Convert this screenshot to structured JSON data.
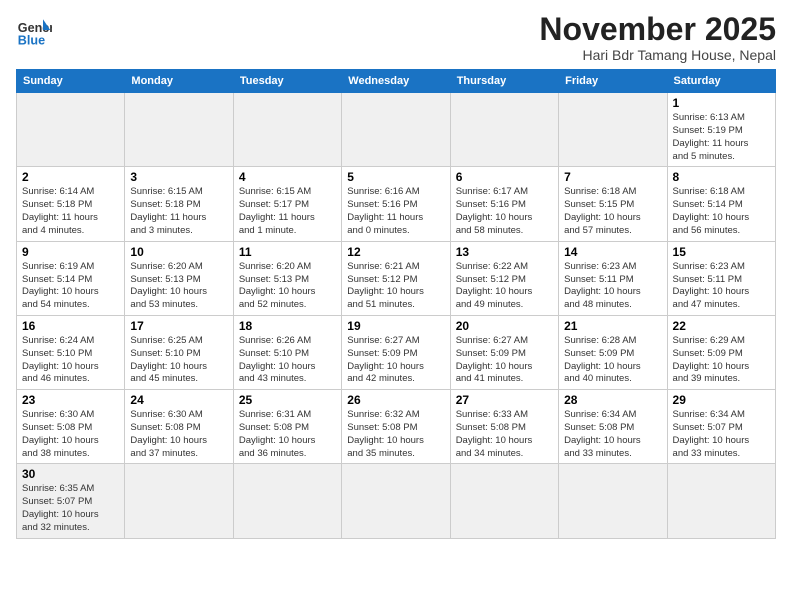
{
  "logo": {
    "general": "General",
    "blue": "Blue"
  },
  "header": {
    "month": "November 2025",
    "subtitle": "Hari Bdr Tamang House, Nepal"
  },
  "weekdays": [
    "Sunday",
    "Monday",
    "Tuesday",
    "Wednesday",
    "Thursday",
    "Friday",
    "Saturday"
  ],
  "weeks": [
    [
      {
        "day": null,
        "info": null
      },
      {
        "day": null,
        "info": null
      },
      {
        "day": null,
        "info": null
      },
      {
        "day": null,
        "info": null
      },
      {
        "day": null,
        "info": null
      },
      {
        "day": null,
        "info": null
      },
      {
        "day": "1",
        "info": "Sunrise: 6:13 AM\nSunset: 5:19 PM\nDaylight: 11 hours\nand 5 minutes."
      }
    ],
    [
      {
        "day": "2",
        "info": "Sunrise: 6:14 AM\nSunset: 5:18 PM\nDaylight: 11 hours\nand 4 minutes."
      },
      {
        "day": "3",
        "info": "Sunrise: 6:15 AM\nSunset: 5:18 PM\nDaylight: 11 hours\nand 3 minutes."
      },
      {
        "day": "4",
        "info": "Sunrise: 6:15 AM\nSunset: 5:17 PM\nDaylight: 11 hours\nand 1 minute."
      },
      {
        "day": "5",
        "info": "Sunrise: 6:16 AM\nSunset: 5:16 PM\nDaylight: 11 hours\nand 0 minutes."
      },
      {
        "day": "6",
        "info": "Sunrise: 6:17 AM\nSunset: 5:16 PM\nDaylight: 10 hours\nand 58 minutes."
      },
      {
        "day": "7",
        "info": "Sunrise: 6:18 AM\nSunset: 5:15 PM\nDaylight: 10 hours\nand 57 minutes."
      },
      {
        "day": "8",
        "info": "Sunrise: 6:18 AM\nSunset: 5:14 PM\nDaylight: 10 hours\nand 56 minutes."
      }
    ],
    [
      {
        "day": "9",
        "info": "Sunrise: 6:19 AM\nSunset: 5:14 PM\nDaylight: 10 hours\nand 54 minutes."
      },
      {
        "day": "10",
        "info": "Sunrise: 6:20 AM\nSunset: 5:13 PM\nDaylight: 10 hours\nand 53 minutes."
      },
      {
        "day": "11",
        "info": "Sunrise: 6:20 AM\nSunset: 5:13 PM\nDaylight: 10 hours\nand 52 minutes."
      },
      {
        "day": "12",
        "info": "Sunrise: 6:21 AM\nSunset: 5:12 PM\nDaylight: 10 hours\nand 51 minutes."
      },
      {
        "day": "13",
        "info": "Sunrise: 6:22 AM\nSunset: 5:12 PM\nDaylight: 10 hours\nand 49 minutes."
      },
      {
        "day": "14",
        "info": "Sunrise: 6:23 AM\nSunset: 5:11 PM\nDaylight: 10 hours\nand 48 minutes."
      },
      {
        "day": "15",
        "info": "Sunrise: 6:23 AM\nSunset: 5:11 PM\nDaylight: 10 hours\nand 47 minutes."
      }
    ],
    [
      {
        "day": "16",
        "info": "Sunrise: 6:24 AM\nSunset: 5:10 PM\nDaylight: 10 hours\nand 46 minutes."
      },
      {
        "day": "17",
        "info": "Sunrise: 6:25 AM\nSunset: 5:10 PM\nDaylight: 10 hours\nand 45 minutes."
      },
      {
        "day": "18",
        "info": "Sunrise: 6:26 AM\nSunset: 5:10 PM\nDaylight: 10 hours\nand 43 minutes."
      },
      {
        "day": "19",
        "info": "Sunrise: 6:27 AM\nSunset: 5:09 PM\nDaylight: 10 hours\nand 42 minutes."
      },
      {
        "day": "20",
        "info": "Sunrise: 6:27 AM\nSunset: 5:09 PM\nDaylight: 10 hours\nand 41 minutes."
      },
      {
        "day": "21",
        "info": "Sunrise: 6:28 AM\nSunset: 5:09 PM\nDaylight: 10 hours\nand 40 minutes."
      },
      {
        "day": "22",
        "info": "Sunrise: 6:29 AM\nSunset: 5:09 PM\nDaylight: 10 hours\nand 39 minutes."
      }
    ],
    [
      {
        "day": "23",
        "info": "Sunrise: 6:30 AM\nSunset: 5:08 PM\nDaylight: 10 hours\nand 38 minutes."
      },
      {
        "day": "24",
        "info": "Sunrise: 6:30 AM\nSunset: 5:08 PM\nDaylight: 10 hours\nand 37 minutes."
      },
      {
        "day": "25",
        "info": "Sunrise: 6:31 AM\nSunset: 5:08 PM\nDaylight: 10 hours\nand 36 minutes."
      },
      {
        "day": "26",
        "info": "Sunrise: 6:32 AM\nSunset: 5:08 PM\nDaylight: 10 hours\nand 35 minutes."
      },
      {
        "day": "27",
        "info": "Sunrise: 6:33 AM\nSunset: 5:08 PM\nDaylight: 10 hours\nand 34 minutes."
      },
      {
        "day": "28",
        "info": "Sunrise: 6:34 AM\nSunset: 5:08 PM\nDaylight: 10 hours\nand 33 minutes."
      },
      {
        "day": "29",
        "info": "Sunrise: 6:34 AM\nSunset: 5:07 PM\nDaylight: 10 hours\nand 33 minutes."
      }
    ],
    [
      {
        "day": "30",
        "info": "Sunrise: 6:35 AM\nSunset: 5:07 PM\nDaylight: 10 hours\nand 32 minutes."
      },
      {
        "day": null,
        "info": null
      },
      {
        "day": null,
        "info": null
      },
      {
        "day": null,
        "info": null
      },
      {
        "day": null,
        "info": null
      },
      {
        "day": null,
        "info": null
      },
      {
        "day": null,
        "info": null
      }
    ]
  ]
}
